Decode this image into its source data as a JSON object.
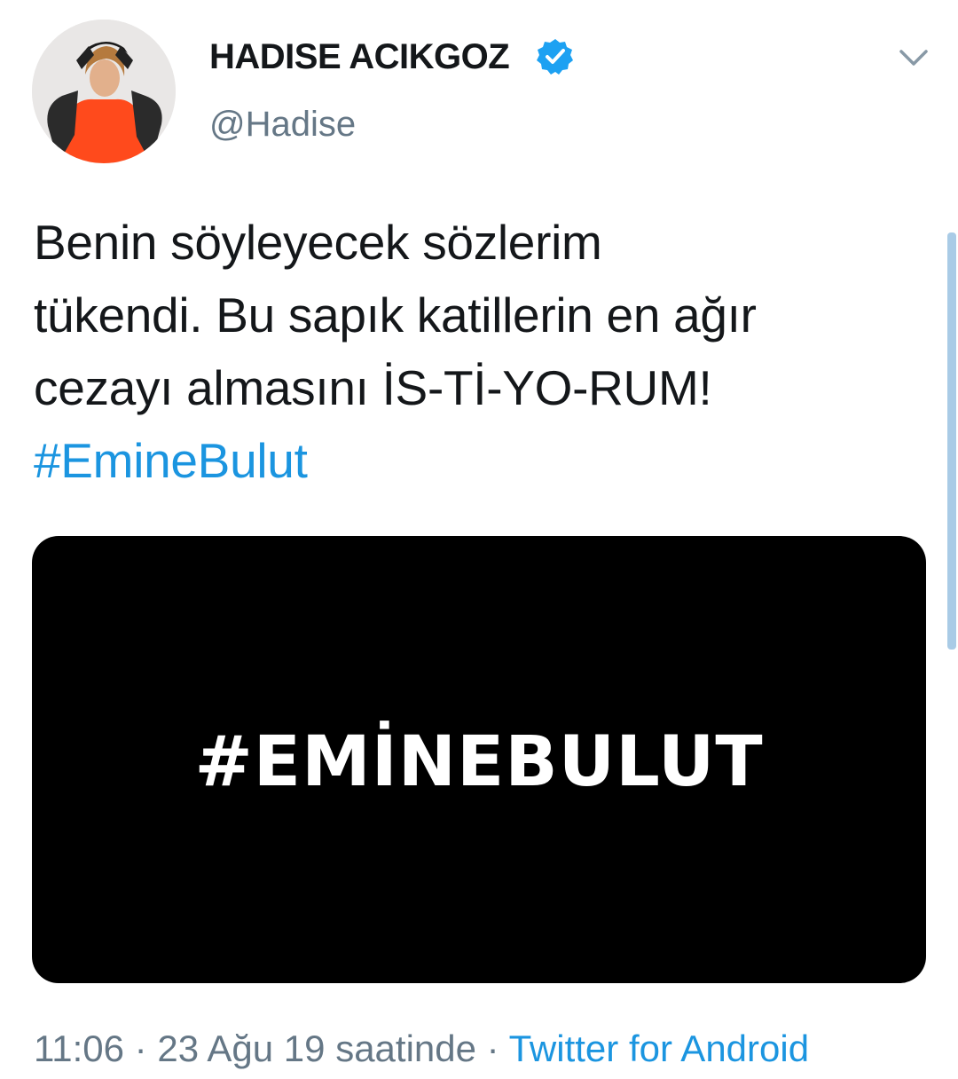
{
  "author": {
    "display_name": "HADISE ACIKGOZ",
    "handle": "@Hadise",
    "verified": true
  },
  "tweet": {
    "text_lines": [
      "Benin söyleyecek sözlerim",
      "tükendi. Bu sapık katillerin en ağır",
      "cezayı almasını İS-Tİ-YO-RUM!"
    ],
    "hashtag": "#EmineBulut"
  },
  "media": {
    "image_text": "#EMİNEBULUT"
  },
  "meta": {
    "time": "11:06",
    "separator": "·",
    "date_label": "23 Ağu 19 saatinde",
    "source": "Twitter for Android"
  },
  "colors": {
    "link": "#1b95e0",
    "secondary_text": "#657786",
    "primary_text": "#14171a",
    "verified": "#1da1f2"
  },
  "icons": {
    "verified": "verified-badge-icon",
    "menu": "chevron-down-icon"
  }
}
